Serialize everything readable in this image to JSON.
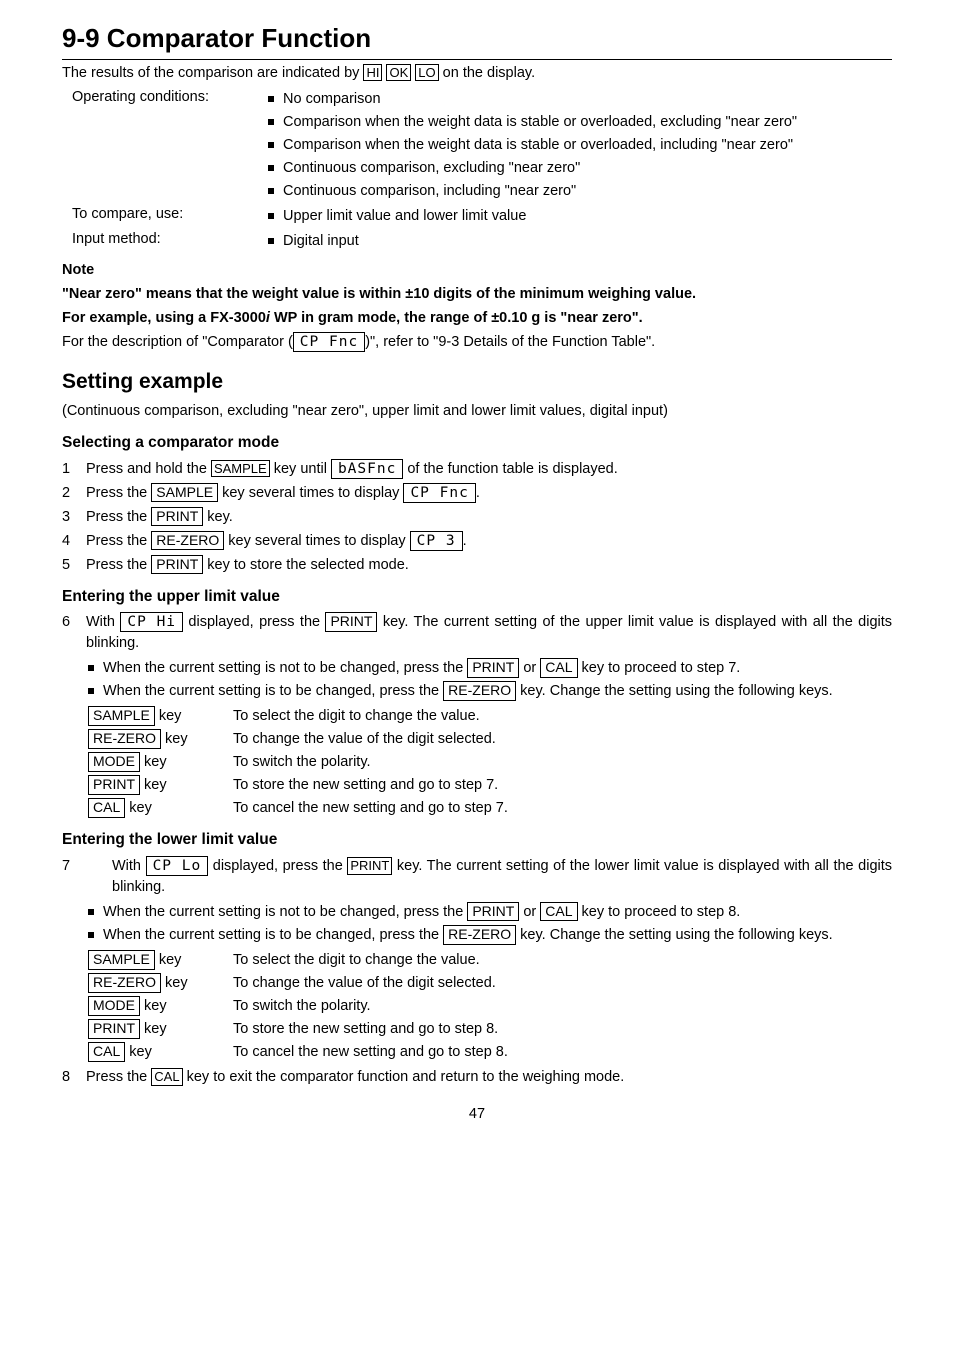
{
  "title": "9-9 Comparator Function",
  "intro_a": "The results of the comparison are indicated by ",
  "intro_b": " on the display.",
  "hi": "HI",
  "ok": "OK",
  "lo": "LO",
  "cond_label": "Operating conditions:",
  "cond_items": [
    "No comparison",
    "Comparison when the weight data is stable or overloaded, excluding \"near zero\"",
    "Comparison when the weight data is stable or overloaded, including \"near zero\"",
    "Continuous comparison, excluding \"near zero\"",
    "Continuous comparison, including \"near zero\""
  ],
  "compare_label": "To compare, use:",
  "compare_item": "Upper limit value and lower limit value",
  "input_label": "Input method:",
  "input_item": "Digital input",
  "note_head": "Note",
  "note_line1": "\"Near zero\" means that the weight value is within ±10 digits of the minimum weighing value.",
  "note_line2_a": "For example, using a FX-3000",
  "note_line2_i": "i",
  "note_line2_b": " WP in gram mode, the range of ±0.10 g is \"near zero\".",
  "note_line3_a": "For the description of \"Comparator (",
  "note_line3_seg": "CP Fnc",
  "note_line3_b": ")\", refer to \"9-3 Details of the Function Table\".",
  "setting_title": "Setting example",
  "setting_sub": "(Continuous comparison, excluding \"near zero\", upper limit and lower limit values, digital input)",
  "sel_title": "Selecting a comparator mode",
  "s1_a": "Press and hold the ",
  "s1_key": "SAMPLE",
  "s1_b": " key until ",
  "s1_seg": " bASFnc ",
  "s1_c": " of the function table is displayed.",
  "s2_a": "Press the ",
  "s2_key": " SAMPLE ",
  "s2_b": " key several times to display ",
  "s2_seg": " CP Fnc ",
  "s2_c": ".",
  "s3_a": "Press the ",
  "s3_key": " PRINT ",
  "s3_b": " key.",
  "s4_a": "Press the ",
  "s4_key": " RE-ZERO ",
  "s4_b": " key several times to display ",
  "s4_seg": " CP  3",
  "s4_c": ".",
  "s5_a": "Press the ",
  "s5_key": " PRINT ",
  "s5_b": " key to store the selected mode.",
  "upper_title": "Entering the upper limit value",
  "u6_a": "With ",
  "u6_seg": " CP Hi ",
  "u6_b": " displayed, press the ",
  "u6_key": " PRINT ",
  "u6_c": " key. The current setting of the upper limit value is displayed with all the digits blinking.",
  "u6_sub1_a": "When the current setting is not to be changed, press the ",
  "u6_sub1_k1": " PRINT ",
  "u6_sub1_b": " or ",
  "u6_sub1_k2": " CAL ",
  "u6_sub1_c": " key to proceed to step 7.",
  "u6_sub2_a": "When the current setting is to be changed, press the ",
  "u6_sub2_k": " RE-ZERO ",
  "u6_sub2_b": " key. Change the setting using the following keys.",
  "kt": {
    "sample": " SAMPLE ",
    "rezero": " RE-ZERO ",
    "mode": " MODE ",
    "print": " PRINT ",
    "cal": " CAL ",
    "keyword": " key",
    "d_sample": "To select the digit to change the value.",
    "d_rezero": "To change the value of the digit selected.",
    "d_mode": "To switch the polarity.",
    "d_print7": "To store the new setting and go to step 7.",
    "d_cal7": "To cancel the new setting and go to step 7.",
    "d_print8": "To store the new setting and go to step 8.",
    "d_cal8": "To cancel the new setting and go to step 8."
  },
  "lower_title": "Entering the lower limit value",
  "l7_a": "With ",
  "l7_seg": " CP Lo ",
  "l7_b": " displayed, press the ",
  "l7_key": "PRINT",
  "l7_c": " key. The current setting of the lower limit value is displayed with all the digits blinking.",
  "l7_sub1_a": "When the current setting is not to be changed, press the ",
  "l7_sub1_k1": " PRINT ",
  "l7_sub1_b": " or ",
  "l7_sub1_k2": " CAL ",
  "l7_sub1_c": " key to proceed to step 8.",
  "l7_sub2_a": "When the current setting is to be changed, press the ",
  "l7_sub2_k": " RE-ZERO ",
  "l7_sub2_b": " key. Change the setting using the following keys.",
  "s8_a": "Press the ",
  "s8_key": "CAL",
  "s8_b": " key to exit the comparator function and return to the weighing mode.",
  "pagenum": "47"
}
